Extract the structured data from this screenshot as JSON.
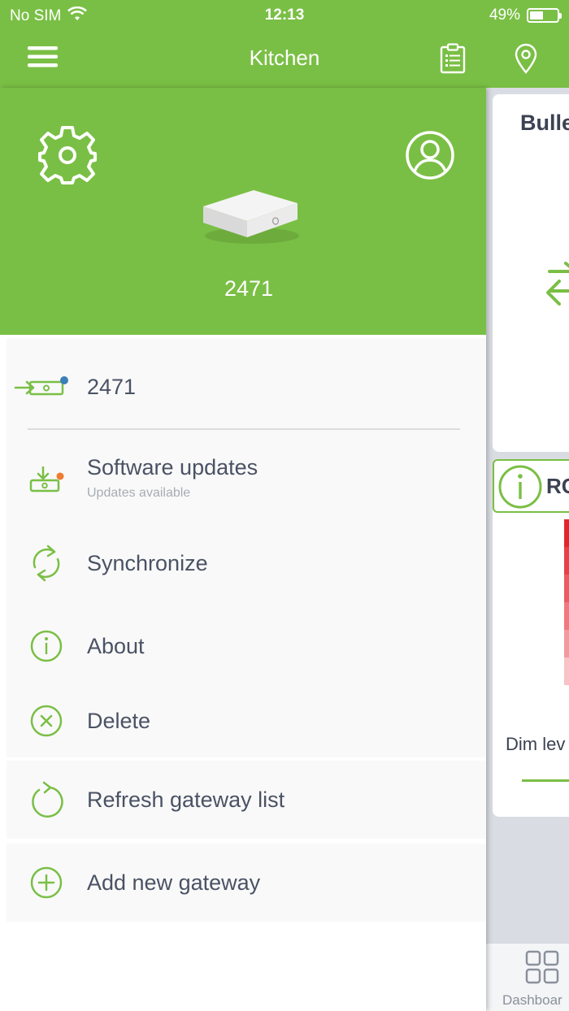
{
  "status_bar": {
    "carrier": "No SIM",
    "time": "12:13",
    "battery": "49%",
    "battery_level": 0.49
  },
  "nav": {
    "title": "Kitchen",
    "menu_icon": "hamburger-icon",
    "clipboard_icon": "clipboard-icon",
    "location_icon": "location-pin-icon"
  },
  "drawer": {
    "hero": {
      "settings_icon": "gear-icon",
      "account_icon": "user-icon",
      "gateway_name": "2471"
    },
    "current_gateway": {
      "label": "2471",
      "status_color": "#3a7fb6"
    },
    "menu": [
      {
        "label": "Software updates",
        "sublabel": "Updates available",
        "icon": "download-gateway-icon",
        "badge_color": "#f07b2d"
      },
      {
        "label": "Synchronize",
        "icon": "sync-icon"
      },
      {
        "label": "About",
        "icon": "info-icon"
      },
      {
        "label": "Delete",
        "icon": "close-circle-icon"
      }
    ],
    "footer_menu": [
      {
        "label": "Refresh gateway list",
        "icon": "refresh-icon"
      },
      {
        "label": "Add new gateway",
        "icon": "add-circle-icon"
      }
    ]
  },
  "dashboard": {
    "card1_title": "Bulle",
    "card2_title": "RC",
    "card2_label": "Dim lev",
    "tab_label": "Dashboar"
  },
  "colors": {
    "accent": "#7abf45",
    "text": "#4a5264"
  }
}
